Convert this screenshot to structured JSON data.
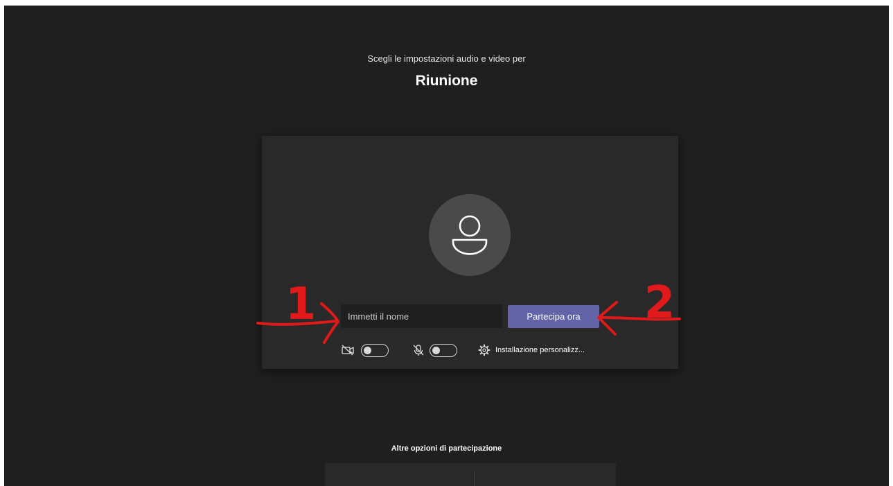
{
  "header": {
    "subtitle": "Scegli le impostazioni audio e video per",
    "meeting_title": "Riunione"
  },
  "prejoin": {
    "name_placeholder": "Immetti il nome",
    "join_label": "Partecipa ora",
    "camera": {
      "icon": "camera-off-icon",
      "on": false
    },
    "microphone": {
      "icon": "microphone-off-icon",
      "on": false
    },
    "settings": {
      "icon": "gear-icon",
      "label": "Installazione personalizz..."
    }
  },
  "other_options": {
    "heading": "Altre opzioni di partecipazione"
  },
  "annotations": {
    "label_1": "1",
    "label_2": "2",
    "color": "#e0191a"
  },
  "colors": {
    "background": "#1f1f1f",
    "card": "#292929",
    "accent": "#6264a7",
    "avatar_bg": "#4a4a4a"
  }
}
